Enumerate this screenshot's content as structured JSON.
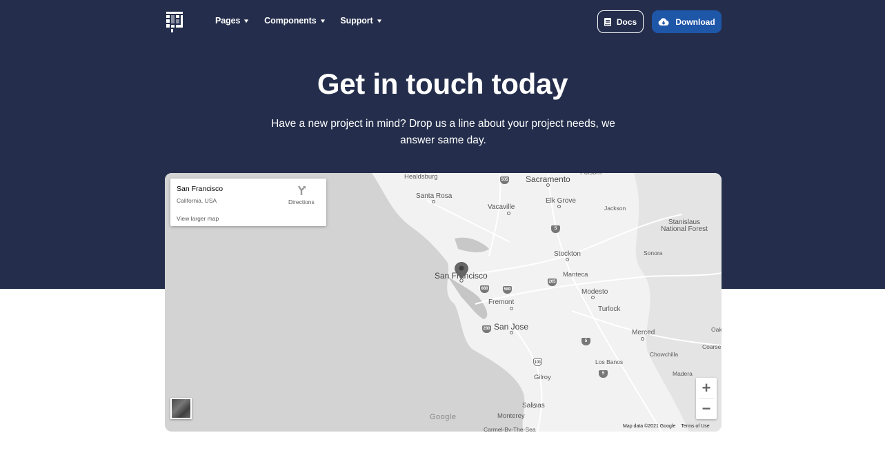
{
  "nav": {
    "logo": "brand-logo",
    "links": [
      {
        "label": "Pages",
        "icon": "chevron-down-icon"
      },
      {
        "label": "Components",
        "icon": "chevron-down-icon"
      },
      {
        "label": "Support",
        "icon": "chevron-down-icon"
      }
    ],
    "docs_label": "Docs",
    "docs_icon": "book-icon",
    "download_label": "Download",
    "download_icon": "cloud-download-icon"
  },
  "hero": {
    "title": "Get in touch today",
    "subtitle": "Have a new project in mind? Drop us a line about your project needs, we answer same day."
  },
  "map": {
    "info_card": {
      "place": "San Francisco",
      "region": "California, USA",
      "directions_label": "Directions",
      "larger_map_label": "View larger map"
    },
    "zoom_in": "+",
    "zoom_out": "−",
    "logo_text": "Google",
    "attribution": "Map data ©2021 Google",
    "terms": "Terms of Use",
    "labels": {
      "healdsburg": "Healdsburg",
      "santa_rosa": "Santa Rosa",
      "vacaville": "Vacaville",
      "sacramento": "Sacramento",
      "folsom": "Folsom",
      "elk_grove": "Elk Grove",
      "jackson": "Jackson",
      "stanislaus": "Stanislaus National Forest",
      "sonora": "Sonora",
      "stockton": "Stockton",
      "san_francisco": "San Francisco",
      "manteca": "Manteca",
      "modesto": "Modesto",
      "fremont": "Fremont",
      "turlock": "Turlock",
      "san_jose": "San Jose",
      "merced": "Merced",
      "chowchilla": "Chowchilla",
      "los_banos": "Los Banos",
      "gilroy": "Gilroy",
      "madera": "Madera",
      "salinas": "Salinas",
      "monterey": "Monterey",
      "carmel": "Carmel-By-The-Sea",
      "oakhurst": "Oak",
      "coarsegold": "Coarse"
    },
    "shields": {
      "i505": "505",
      "i5a": "5",
      "i880": "880",
      "i580": "580",
      "i205": "205",
      "i280": "280",
      "i5b": "5",
      "us101": "101",
      "i5c": "5"
    }
  }
}
